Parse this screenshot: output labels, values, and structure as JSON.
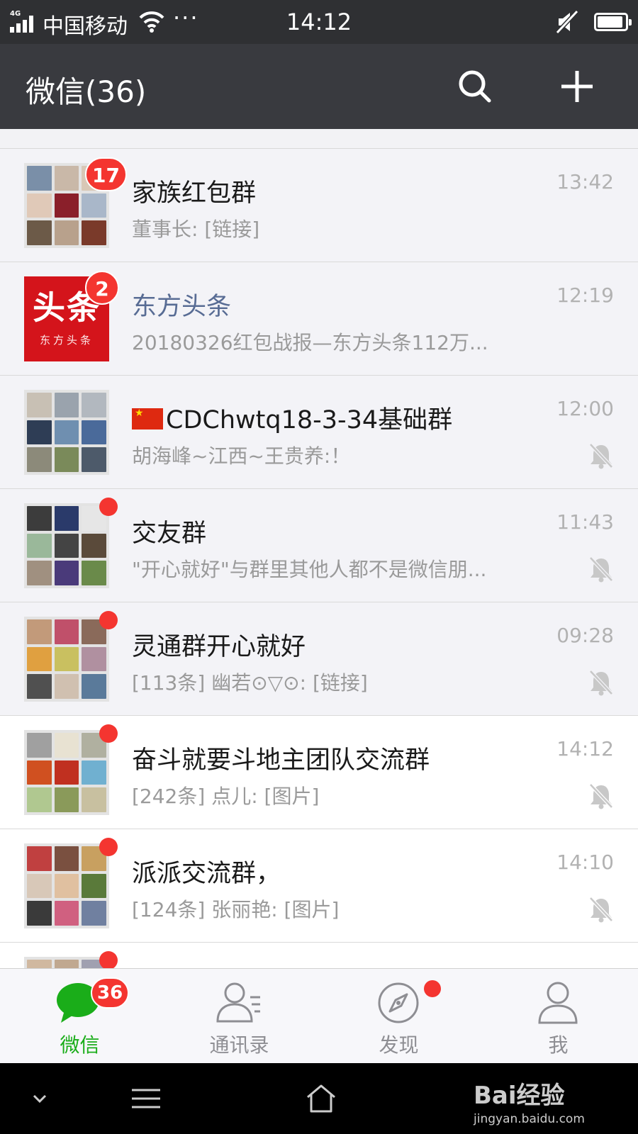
{
  "status_bar": {
    "network": "4G",
    "carrier": "中国移动",
    "dots": "···",
    "time": "14:12",
    "battery_level": 0.92
  },
  "header": {
    "title": "微信(36)",
    "search_icon": "search-icon",
    "add_icon": "plus-icon"
  },
  "chats": [
    {
      "name": "家族红包群",
      "preview": "董事长: [链接]",
      "time": "13:42",
      "badge": "17",
      "muted": false,
      "pinned": true
    },
    {
      "name": "东方头条",
      "preview": "20180326红包战报—东方头条112万...",
      "time": "12:19",
      "badge": "2",
      "muted": false,
      "pinned": true,
      "logo_text": "头条",
      "logo_sub": "东方头条"
    },
    {
      "name": "CDChwtq18-3-34基础群",
      "preview": "胡海峰~江西~王贵养:！",
      "time": "12:00",
      "badge": "",
      "muted": true,
      "pinned": true,
      "flag": "china-flag-icon"
    },
    {
      "name": "交友群",
      "preview": "\"开心就好\"与群里其他人都不是微信朋...",
      "time": "11:43",
      "badge": "",
      "dot": true,
      "muted": true,
      "pinned": true
    },
    {
      "name": "灵通群开心就好",
      "preview": "[113条] 幽若⊙▽⊙: [链接]",
      "time": "09:28",
      "badge": "",
      "dot": true,
      "muted": true,
      "pinned": true
    },
    {
      "name": "奋斗就要斗地主团队交流群",
      "preview": "[242条] 点儿: [图片]",
      "time": "14:12",
      "badge": "",
      "dot": true,
      "muted": true,
      "pinned": false
    },
    {
      "name": "派派交流群，",
      "preview": "[124条] 张丽艳: [图片]",
      "time": "14:10",
      "badge": "",
      "dot": true,
      "muted": true,
      "pinned": false
    }
  ],
  "tabs": [
    {
      "label": "微信",
      "icon": "chat-bubble-icon",
      "active": true,
      "badge": "36"
    },
    {
      "label": "通讯录",
      "icon": "contacts-icon",
      "active": false
    },
    {
      "label": "发现",
      "icon": "compass-icon",
      "active": false,
      "dot": true
    },
    {
      "label": "我",
      "icon": "person-icon",
      "active": false
    }
  ],
  "watermark": {
    "brand": "Bai经验",
    "url": "jingyan.baidu.com"
  },
  "colors": {
    "accent": "#1aad19",
    "badge": "#f43530",
    "header": "#393a3f",
    "statusbar": "#2f3033"
  }
}
